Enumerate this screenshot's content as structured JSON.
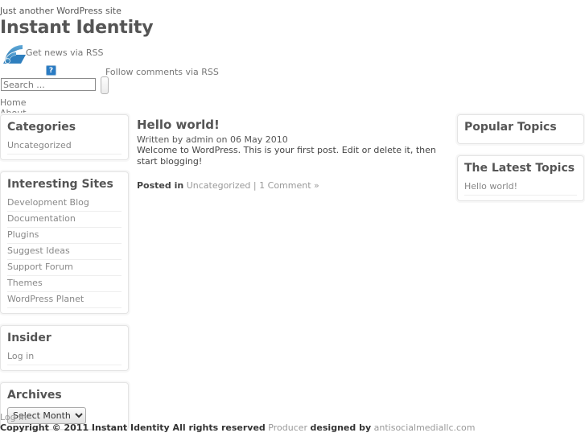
{
  "header": {
    "tagline": "Just another WordPress site",
    "site_title": "Instant Identity",
    "rss_news_label": "Get news via RSS",
    "rss_comments_label": "Follow comments via RSS",
    "broken_image_glyph": "?"
  },
  "search": {
    "placeholder": "Search ...",
    "value": "",
    "submit_label": ""
  },
  "nav": {
    "items": [
      {
        "label": "Home"
      },
      {
        "label": "About"
      }
    ]
  },
  "left_sidebar": {
    "widgets": [
      {
        "title": "Categories",
        "items": [
          {
            "label": "Uncategorized"
          }
        ]
      },
      {
        "title": "Interesting Sites",
        "items": [
          {
            "label": "Development Blog"
          },
          {
            "label": "Documentation"
          },
          {
            "label": "Plugins"
          },
          {
            "label": "Suggest Ideas"
          },
          {
            "label": "Support Forum"
          },
          {
            "label": "Themes"
          },
          {
            "label": "WordPress Planet"
          }
        ]
      },
      {
        "title": "Insider",
        "items": [
          {
            "label": "Log in"
          }
        ]
      },
      {
        "title": "Archives",
        "select_label": "Select Month"
      }
    ]
  },
  "main": {
    "post": {
      "title": "Hello world!",
      "meta": "Written by admin on 06 May 2010",
      "body": "Welcome to WordPress. This is your first post. Edit or delete it, then start blogging!",
      "posted_in_label": "Posted in",
      "category": "Uncategorized",
      "separator": "|",
      "comments": "1 Comment »"
    }
  },
  "right_sidebar": {
    "widgets": [
      {
        "title": "Popular Topics",
        "items": []
      },
      {
        "title": "The Latest Topics",
        "items": [
          {
            "label": "Hello world!"
          }
        ]
      }
    ]
  },
  "footer": {
    "login_label": "Log in",
    "copyright_prefix": "Copyright © 2011 Instant Identity All rights reserved",
    "producer": "Producer",
    "designed_by": "designed by",
    "designer_link": "antisocialmediallc.com"
  },
  "colors": {
    "text": "#555555",
    "link": "#888888",
    "rss_blue": "#2b7cc4",
    "widget_border": "#e4e4e4"
  }
}
